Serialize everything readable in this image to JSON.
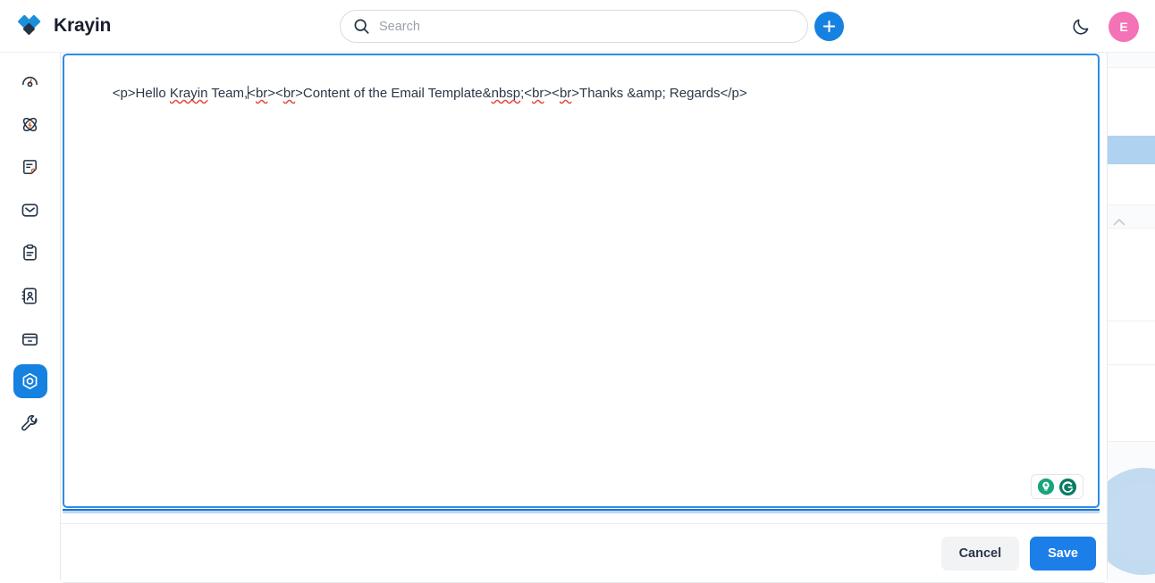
{
  "app": {
    "brand_name": "Krayin",
    "logo_icon": "krayin-diamond-logo"
  },
  "header": {
    "search": {
      "placeholder": "Search",
      "value": "",
      "icon": "search-icon"
    },
    "add_button": {
      "icon": "plus-icon",
      "label": "+"
    },
    "dark_mode_toggle": {
      "icon": "moon-icon"
    },
    "avatar": {
      "initial": "E",
      "color": "#f472b6"
    }
  },
  "sidebar": {
    "items": [
      {
        "icon": "dashboard-gauge-icon",
        "name": "dashboard",
        "active": false
      },
      {
        "icon": "leads-atom-icon",
        "name": "leads",
        "active": false
      },
      {
        "icon": "quotes-note-icon",
        "name": "quotes",
        "active": false
      },
      {
        "icon": "mail-envelope-icon",
        "name": "mail",
        "active": false
      },
      {
        "icon": "activities-clipboard-icon",
        "name": "activities",
        "active": false
      },
      {
        "icon": "contacts-book-icon",
        "name": "contacts",
        "active": false
      },
      {
        "icon": "products-box-icon",
        "name": "products",
        "active": false
      },
      {
        "icon": "settings-hexagon-icon",
        "name": "settings",
        "active": true
      },
      {
        "icon": "configuration-wrench-icon",
        "name": "configuration",
        "active": false
      }
    ]
  },
  "modal": {
    "editor": {
      "name": "email-template-html-editor",
      "content": "<p>Hello Krayin Team,<br><br>Content of the Email Template&nbsp;<br><br>Thanks &amp; Regards</p>",
      "segments": [
        {
          "text": "<p>Hello ",
          "spellcheck_error": false
        },
        {
          "text": "Krayin",
          "spellcheck_error": true
        },
        {
          "text": " Team,",
          "spellcheck_error": false
        },
        {
          "text": "caret",
          "spellcheck_error": false
        },
        {
          "text": "<",
          "spellcheck_error": false
        },
        {
          "text": "br",
          "spellcheck_error": true
        },
        {
          "text": "><",
          "spellcheck_error": false
        },
        {
          "text": "br",
          "spellcheck_error": true
        },
        {
          "text": ">Content of the Email Template&",
          "spellcheck_error": false
        },
        {
          "text": "nbsp",
          "spellcheck_error": true
        },
        {
          "text": ";<",
          "spellcheck_error": false
        },
        {
          "text": "br",
          "spellcheck_error": true
        },
        {
          "text": "><",
          "spellcheck_error": false
        },
        {
          "text": "br",
          "spellcheck_error": true
        },
        {
          "text": ">Thanks &amp; Regards</p>",
          "spellcheck_error": false
        }
      ],
      "grammarly": {
        "lightbulb_icon": "grammarly-assistant-lightbulb-icon",
        "logo_icon": "grammarly-g-logo-icon"
      }
    },
    "footer": {
      "cancel_label": "Cancel",
      "save_label": "Save"
    }
  },
  "colors": {
    "accent_blue": "#1c7ee8",
    "logo_blue": "#1b8fd9",
    "logo_navy": "#243447",
    "avatar_pink": "#f472b6",
    "editor_focus_border": "#2d8ce6",
    "spellcheck_red": "#e8453c",
    "grammarly_green": "#15a47b"
  }
}
